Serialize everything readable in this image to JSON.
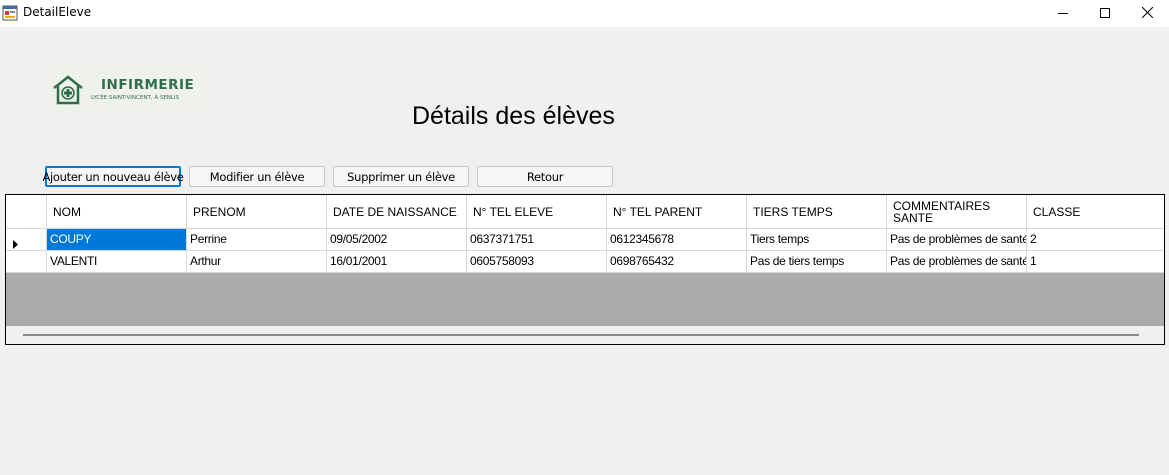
{
  "window": {
    "title": "DetailEleve",
    "minimize_icon": "minimize-icon",
    "maximize_icon": "maximize-icon",
    "close_icon": "close-icon"
  },
  "logo": {
    "name": "INFIRMERIE",
    "subtitle": "LYCÉE SAINT-VINCENT, À SENLIS",
    "color": "#2f6e4d"
  },
  "page_title": "Détails des élèves",
  "buttons": {
    "add": "Ajouter un nouveau élève",
    "edit": "Modifier un élève",
    "delete": "Supprimer un élève",
    "back": "Retour"
  },
  "grid": {
    "columns": [
      "NOM",
      "PRENOM",
      "DATE DE NAISSANCE",
      "N° TEL ELEVE",
      "N° TEL PARENT",
      "TIERS TEMPS",
      "COMMENTAIRES SANTE",
      "CLASSE"
    ],
    "rows": [
      [
        "COUPY",
        "Perrine",
        "09/05/2002",
        "0637371751",
        "0612345678",
        "Tiers temps",
        "Pas de problèmes de santé",
        "2"
      ],
      [
        "VALENTI",
        "Arthur",
        "16/01/2001",
        "0605758093",
        "0698765432",
        "Pas de tiers temps",
        "Pas de problèmes de santé",
        "1"
      ]
    ],
    "selected_cell": {
      "row": 0,
      "column": 0
    },
    "selection_color": "#0078d7"
  }
}
